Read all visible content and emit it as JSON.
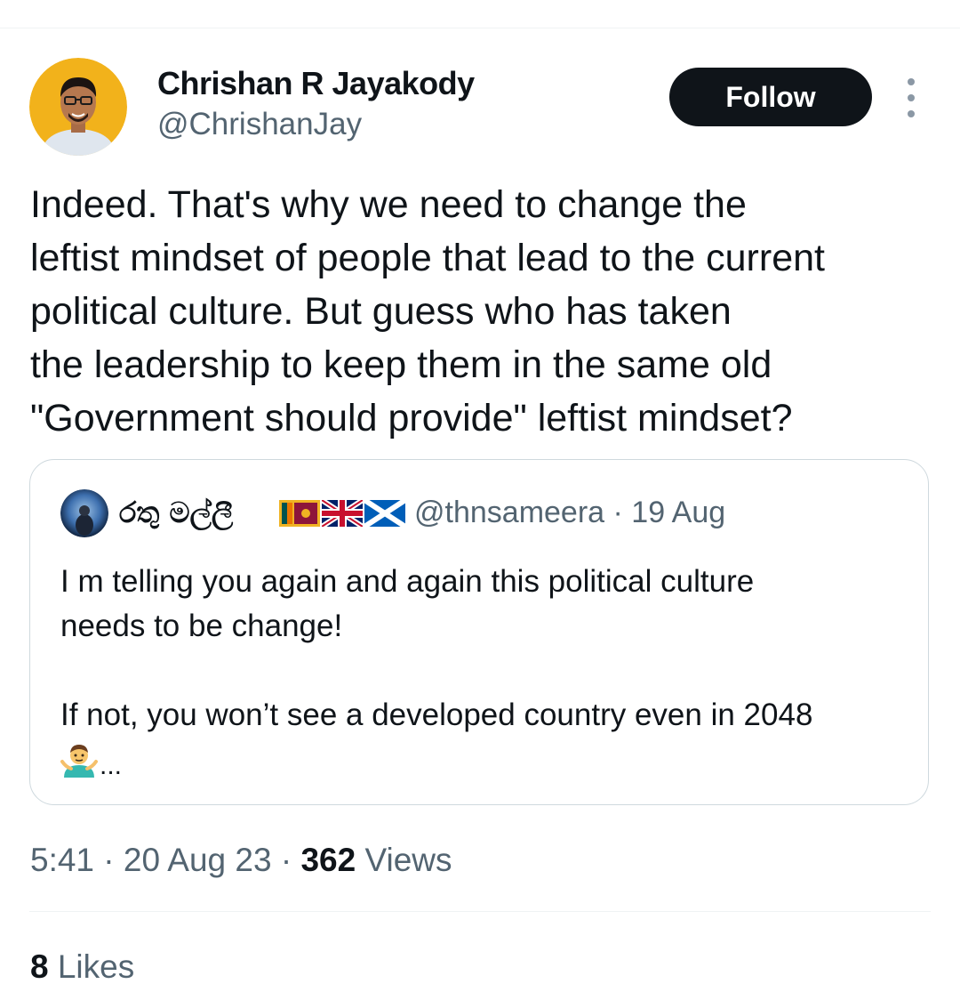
{
  "author": {
    "name": "Chrishan R Jayakody",
    "handle": "@ChrishanJay"
  },
  "follow_label": "Follow",
  "tweet_text": "Indeed. That's why we need to change the\nleftist mindset of people that lead to the current\npolitical culture. But guess who has taken\nthe leadership to keep them in the same old\n\"Government should provide\" leftist mindset?",
  "quoted_tweet": {
    "author_name": "රතු මල්ලී",
    "flags": [
      "flag-sri-lanka",
      "flag-united-kingdom",
      "flag-scotland"
    ],
    "handle": "@thnsameera",
    "separator": "·",
    "date": "19 Aug",
    "text": "I m telling you again and again this political culture\nneeds to be change!\n\nIf not, you won’t see a developed country even in 2048",
    "trailing_emoji": "man-shrugging-emoji",
    "ellipsis": "..."
  },
  "meta": {
    "time": "5:41",
    "date": "20 Aug 23",
    "separator": "·",
    "views_count": "362",
    "views_label": "Views"
  },
  "likes": {
    "count": "8",
    "label": "Likes"
  },
  "colors": {
    "text_primary": "#0f1419",
    "text_secondary": "#536471",
    "border": "#cfd9de",
    "divider": "#eff3f4",
    "follow_bg": "#0f1419",
    "follow_text": "#ffffff",
    "avatar_bg": "#f2b21b"
  }
}
